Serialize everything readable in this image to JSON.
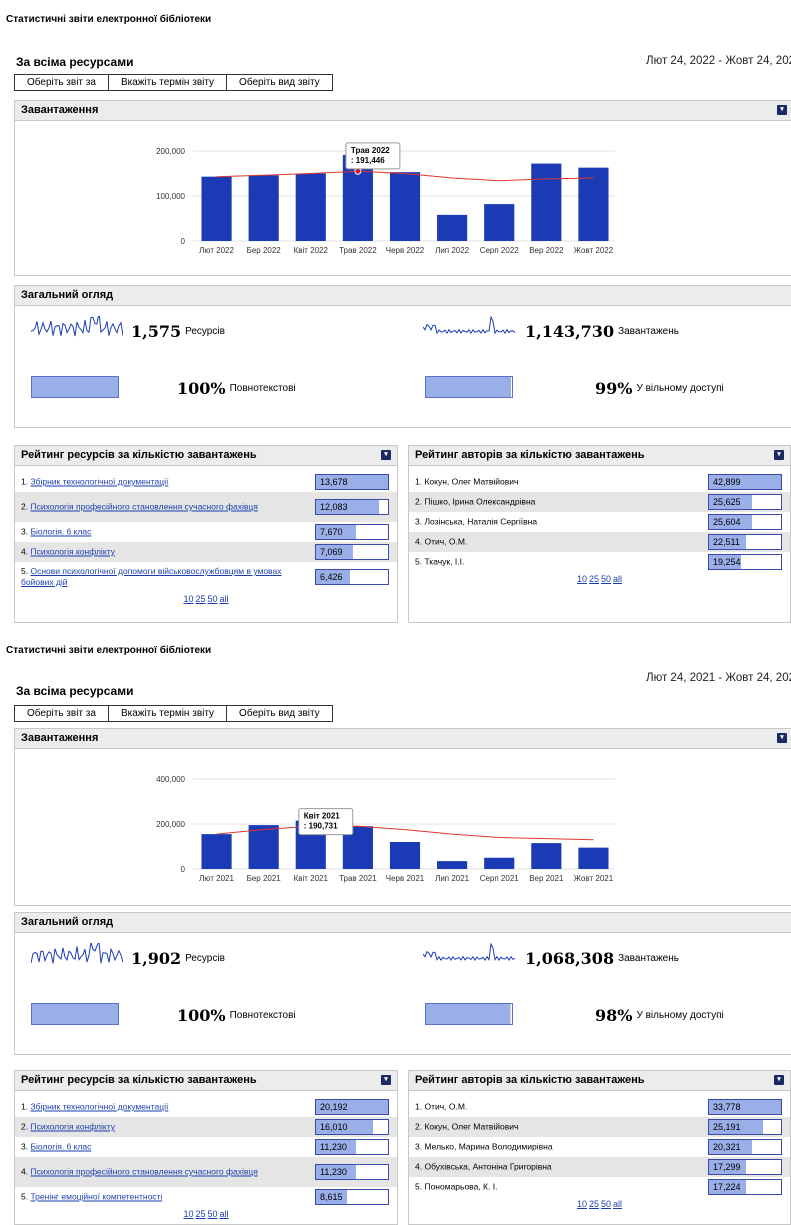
{
  "reports": [
    {
      "page_title": "Статистичні звіти електронної бібліотеки",
      "scope_title": "За всіма ресурсами",
      "date_range": "Лют 24, 2022 - Жовт 24, 202",
      "buttons": [
        "Оберіть звіт за",
        "Вкажіть термін звіту",
        "Оберіть вид звіту"
      ],
      "downloads_title": "Завантаження",
      "overview_title": "Загальний огляд",
      "resources_count": "1,575",
      "resources_label": "Ресурсів",
      "downloads_count": "1,143,730",
      "downloads_label": "Завантажень",
      "fulltext_pct": "100%",
      "fulltext_label": "Повнотекстові",
      "open_pct": "99%",
      "open_label": "У вільному доступі",
      "open_fraction": 0.99,
      "res_rank_title": "Рейтинг ресурсів за кількістю завантажень",
      "auth_rank_title": "Рейтинг авторів за кількістю завантажень",
      "resources": [
        {
          "n": "1.",
          "name": "Збірник технологічної документації",
          "value": "13,678",
          "fraction": 1.0
        },
        {
          "n": "2.",
          "name": "Психологія професійного становлення сучасного фахівця",
          "value": "12,083",
          "fraction": 0.88
        },
        {
          "n": "3.",
          "name": "Біологія. 6 клас",
          "value": "7,670",
          "fraction": 0.56
        },
        {
          "n": "4.",
          "name": "Психологія конфлікту",
          "value": "7,069",
          "fraction": 0.52
        },
        {
          "n": "5.",
          "name": "Основи психологічної допомоги військовослужбовцям в умовах бойових дій",
          "value": "6,426",
          "fraction": 0.47
        }
      ],
      "authors": [
        {
          "n": "1.",
          "name": "Кокун, Олег Матвійович",
          "value": "42,899",
          "fraction": 1.0
        },
        {
          "n": "2.",
          "name": "Пішко, Ірина Олександрівна",
          "value": "25,625",
          "fraction": 0.6
        },
        {
          "n": "3.",
          "name": "Лозінська, Наталія Сергіївна",
          "value": "25,604",
          "fraction": 0.6
        },
        {
          "n": "4.",
          "name": "Отич, О.М.",
          "value": "22,511",
          "fraction": 0.52
        },
        {
          "n": "5.",
          "name": "Ткачук, І.І.",
          "value": "19,254",
          "fraction": 0.45
        }
      ],
      "pager": [
        "10",
        "25",
        "50",
        "all"
      ],
      "chart_data": {
        "type": "bar",
        "categories": [
          "Лют 2022",
          "Бер 2022",
          "Квіт 2022",
          "Трав 2022",
          "Черв 2022",
          "Лип 2022",
          "Серп 2022",
          "Вер 2022",
          "Жовт 2022"
        ],
        "values": [
          143000,
          146000,
          150000,
          191446,
          153000,
          58000,
          82000,
          172000,
          163000
        ],
        "trend": [
          143000,
          146000,
          150000,
          155000,
          150000,
          140000,
          134000,
          138000,
          140000
        ],
        "yticks": [
          "0",
          "100,000",
          "200,000"
        ],
        "ylim": [
          0,
          200000
        ],
        "tooltip": {
          "category": "Трав 2022",
          "value": ": 191,446",
          "index": 3
        },
        "bar_color": "#1a3bb5",
        "trend_color": "#e0352b"
      }
    },
    {
      "page_title": "Статистичні звіти електронної бібліотеки",
      "scope_title": "За всіма ресурсами",
      "date_range": "Лют 24, 2021 - Жовт 24, 202",
      "buttons": [
        "Оберіть звіт за",
        "Вкажіть термін звіту",
        "Оберіть вид звіту"
      ],
      "downloads_title": "Завантаження",
      "overview_title": "Загальний огляд",
      "resources_count": "1,902",
      "resources_label": "Ресурсів",
      "downloads_count": "1,068,308",
      "downloads_label": "Завантажень",
      "fulltext_pct": "100%",
      "fulltext_label": "Повнотекстові",
      "open_pct": "98%",
      "open_label": "У вільному доступі",
      "open_fraction": 0.98,
      "res_rank_title": "Рейтинг ресурсів за кількістю завантажень",
      "auth_rank_title": "Рейтинг авторів за кількістю завантажень",
      "resources": [
        {
          "n": "1.",
          "name": "Збірник технологічної документації",
          "value": "20,192",
          "fraction": 1.0
        },
        {
          "n": "2.",
          "name": "Психологія конфлікту",
          "value": "16,010",
          "fraction": 0.79
        },
        {
          "n": "3.",
          "name": "Біологія. 6 клас",
          "value": "11,230",
          "fraction": 0.56
        },
        {
          "n": "4.",
          "name": "Психологія професійного становлення сучасного фахівця",
          "value": "11,230",
          "fraction": 0.56
        },
        {
          "n": "5.",
          "name": "Тренінг емоційної компетентності",
          "value": "8,615",
          "fraction": 0.43
        }
      ],
      "authors": [
        {
          "n": "1.",
          "name": "Отич, О.М.",
          "value": "33,778",
          "fraction": 1.0
        },
        {
          "n": "2.",
          "name": "Кокун, Олег Матвійович",
          "value": "25,191",
          "fraction": 0.75
        },
        {
          "n": "3.",
          "name": "Мелько, Марина Володимирівна",
          "value": "20,321",
          "fraction": 0.6
        },
        {
          "n": "4.",
          "name": "Обухівська, Антоніна Григорівна",
          "value": "17,299",
          "fraction": 0.51
        },
        {
          "n": "5.",
          "name": "Пономарьова, К. І.",
          "value": "17,224",
          "fraction": 0.51
        }
      ],
      "pager": [
        "10",
        "25",
        "50",
        "all"
      ],
      "chart_data": {
        "type": "bar",
        "categories": [
          "Лют 2021",
          "Бер 2021",
          "Квіт 2021",
          "Трав 2021",
          "Черв 2021",
          "Лип 2021",
          "Серп 2021",
          "Вер 2021",
          "Жовт 2021"
        ],
        "values": [
          155000,
          195000,
          215000,
          190000,
          120000,
          35000,
          50000,
          115000,
          95000
        ],
        "trend": [
          155000,
          175000,
          190731,
          190000,
          175000,
          155000,
          140000,
          135000,
          130000
        ],
        "yticks": [
          "0",
          "200,000",
          "400,000"
        ],
        "ylim": [
          0,
          400000
        ],
        "tooltip": {
          "category": "Квіт 2021",
          "value": ": 190,731",
          "index": 2
        },
        "bar_color": "#1a3bb5",
        "trend_color": "#e0352b"
      }
    }
  ]
}
